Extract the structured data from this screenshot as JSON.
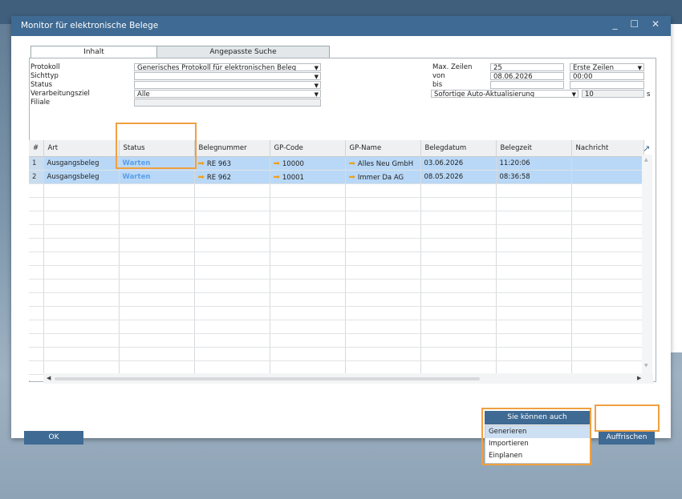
{
  "window": {
    "title": "Monitor für elektronische Belege",
    "controls": [
      "_",
      "☐",
      "✕"
    ]
  },
  "tabs": [
    {
      "label": "Inhalt",
      "active": true
    },
    {
      "label": "Angepasste Suche",
      "active": false
    }
  ],
  "form": {
    "protokoll_label": "Protokoll",
    "protokoll_value": "Generisches Protokoll für elektronischen Beleg",
    "sichttyp_label": "Sichttyp",
    "sichttyp_value": "",
    "status_label": "Status",
    "status_value": "",
    "verarbeitungsziel_label": "Verarbeitungsziel",
    "verarbeitungsziel_value": "Alle",
    "filiale_label": "Filiale",
    "filiale_value": "",
    "max_zeilen_label": "Max. Zeilen",
    "max_zeilen_value": "25",
    "zeilen_mode_value": "Erste Zeilen",
    "von_label": "von",
    "von_date": "08.06.2026",
    "von_time": "00:00",
    "bis_label": "bis",
    "bis_date": "",
    "bis_time": "",
    "aktualisierung_value": "Sofortige Auto-Aktualisierung",
    "interval_value": "10",
    "interval_unit": "s"
  },
  "grid": {
    "columns": [
      "#",
      "Art",
      "Status",
      "Belegnummer",
      "GP-Code",
      "GP-Name",
      "Belegdatum",
      "Belegzeit",
      "Nachricht"
    ],
    "rows": [
      {
        "num": "1",
        "art": "Ausgangsbeleg",
        "status": "Warten",
        "belegnummer": "RE 963",
        "gp_code": "10000",
        "gp_name": "Alles Neu GmbH",
        "belegdatum": "03.06.2026",
        "belegzeit": "11:20:06",
        "nachricht": ""
      },
      {
        "num": "2",
        "art": "Ausgangsbeleg",
        "status": "Warten",
        "belegnummer": "RE 962",
        "gp_code": "10001",
        "gp_name": "Immer Da AG",
        "belegdatum": "08.05.2026",
        "belegzeit": "08:36:58",
        "nachricht": ""
      }
    ],
    "empty_row_count": 17
  },
  "icons": {
    "link_arrow": "➡",
    "dropdown": "▼",
    "expand": "↗",
    "scroll_up": "▲",
    "scroll_down": "▼",
    "scroll_left": "◀",
    "scroll_right": "▶"
  },
  "buttons": {
    "ok_label": "OK",
    "sie_koennen_auch_label": "Sie können auch",
    "auffrischen_label": "Auffrischen"
  },
  "menu": {
    "items": [
      "Generieren",
      "Importieren",
      "Einplanen"
    ],
    "highlighted": "Generieren"
  },
  "colors": {
    "titlebar": "#3e6a93",
    "selected_row": "#b9d8f7",
    "status_text": "#5b9ee8",
    "highlight_box": "#f0a040",
    "arrow": "#f0a01a"
  }
}
